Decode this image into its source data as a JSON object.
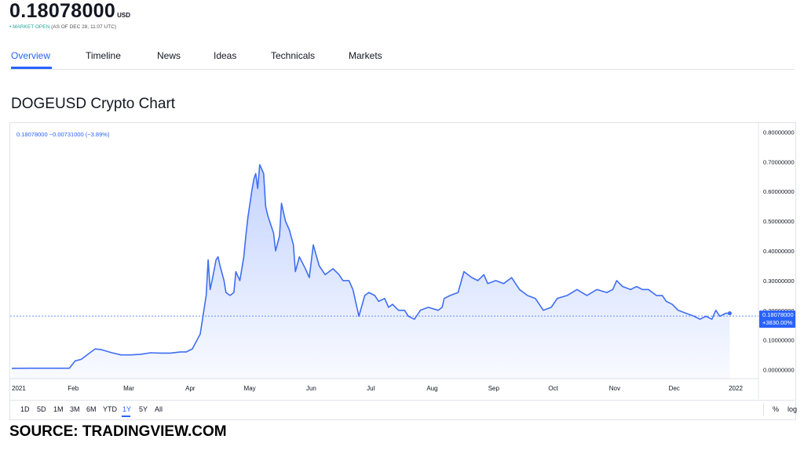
{
  "header": {
    "price": "0.18078000",
    "unit": "USD",
    "status_dot": "•",
    "market_status": "MARKET OPEN",
    "as_of": "(AS OF DEC 28, 11:07 UTC)"
  },
  "tabs": [
    {
      "label": "Overview",
      "active": true
    },
    {
      "label": "Timeline"
    },
    {
      "label": "News"
    },
    {
      "label": "Ideas"
    },
    {
      "label": "Technicals"
    },
    {
      "label": "Markets"
    }
  ],
  "section_title": "DOGEUSD Crypto Chart",
  "source": "SOURCE: TRADINGVIEW.COM",
  "colors": {
    "accent": "#2962ff",
    "line": "#3f6ef2",
    "market_open": "#26a69a"
  },
  "chart_data": {
    "type": "area",
    "series_header": "0.18078000  −0.00731000 (−3.89%)",
    "y_ticks": [
      "0.80000000",
      "0.70000000",
      "0.60000000",
      "0.50000000",
      "0.40000000",
      "0.30000000",
      "0.20000000",
      "0.10000000",
      "0.00000000"
    ],
    "y_tick_values": [
      0.8,
      0.7,
      0.6,
      0.5,
      0.4,
      0.3,
      0.2,
      0.1,
      0.0
    ],
    "ylim": [
      -0.03,
      0.83
    ],
    "x_tick_labels": [
      "2021",
      "Feb",
      "Mar",
      "Apr",
      "May",
      "Jun",
      "Jul",
      "Aug",
      "Sep",
      "Oct",
      "Nov",
      "Dec",
      "2022"
    ],
    "x_tick_days": [
      0,
      31,
      59,
      90,
      120,
      151,
      181,
      212,
      243,
      273,
      304,
      334,
      365
    ],
    "xlim_days": [
      0,
      365
    ],
    "last_value_label": "0.18078000",
    "last_change_label": "+3830.00%",
    "last_value": 0.1808,
    "x_days": [
      0,
      10,
      20,
      29,
      32,
      35,
      40,
      42,
      45,
      50,
      55,
      60,
      65,
      70,
      75,
      80,
      85,
      88,
      91,
      95,
      98,
      99,
      100,
      101,
      103,
      104,
      105,
      107,
      108,
      110,
      112,
      113,
      115,
      117,
      118,
      119,
      121,
      122,
      123,
      124,
      125,
      127,
      128,
      129,
      130,
      132,
      133,
      135,
      136,
      138,
      140,
      142,
      143,
      145,
      148,
      150,
      152,
      155,
      158,
      160,
      162,
      165,
      167,
      170,
      172,
      175,
      178,
      180,
      183,
      185,
      188,
      190,
      192,
      195,
      198,
      200,
      203,
      206,
      210,
      215,
      217,
      218,
      221,
      225,
      228,
      232,
      235,
      238,
      240,
      244,
      248,
      252,
      256,
      260,
      264,
      268,
      272,
      275,
      280,
      285,
      290,
      295,
      300,
      303,
      305,
      308,
      312,
      315,
      318,
      321,
      325,
      328,
      330,
      333,
      336,
      340,
      344,
      347,
      350,
      353,
      355,
      357,
      360,
      362
    ],
    "values": [
      0.0047,
      0.005,
      0.005,
      0.005,
      0.03,
      0.035,
      0.06,
      0.07,
      0.068,
      0.058,
      0.05,
      0.05,
      0.052,
      0.057,
      0.056,
      0.056,
      0.06,
      0.06,
      0.07,
      0.12,
      0.25,
      0.37,
      0.27,
      0.3,
      0.37,
      0.38,
      0.35,
      0.3,
      0.26,
      0.25,
      0.26,
      0.33,
      0.3,
      0.38,
      0.45,
      0.51,
      0.6,
      0.64,
      0.66,
      0.61,
      0.69,
      0.66,
      0.55,
      0.52,
      0.5,
      0.46,
      0.4,
      0.45,
      0.56,
      0.5,
      0.47,
      0.42,
      0.33,
      0.38,
      0.34,
      0.31,
      0.42,
      0.35,
      0.32,
      0.33,
      0.34,
      0.32,
      0.3,
      0.3,
      0.27,
      0.18,
      0.25,
      0.26,
      0.25,
      0.23,
      0.24,
      0.21,
      0.22,
      0.2,
      0.2,
      0.18,
      0.17,
      0.2,
      0.21,
      0.2,
      0.21,
      0.24,
      0.25,
      0.26,
      0.33,
      0.31,
      0.3,
      0.32,
      0.29,
      0.3,
      0.29,
      0.31,
      0.27,
      0.25,
      0.24,
      0.2,
      0.21,
      0.24,
      0.25,
      0.27,
      0.25,
      0.27,
      0.26,
      0.27,
      0.3,
      0.28,
      0.27,
      0.28,
      0.27,
      0.27,
      0.25,
      0.25,
      0.23,
      0.22,
      0.2,
      0.19,
      0.18,
      0.17,
      0.18,
      0.17,
      0.2,
      0.18,
      0.19,
      0.19
    ]
  },
  "range_buttons": [
    {
      "label": "1D"
    },
    {
      "label": "5D"
    },
    {
      "label": "1M"
    },
    {
      "label": "3M"
    },
    {
      "label": "6M"
    },
    {
      "label": "YTD"
    },
    {
      "label": "1Y",
      "active": true
    },
    {
      "label": "5Y"
    },
    {
      "label": "All"
    }
  ],
  "scale_toggles": {
    "percent": "%",
    "log": "log"
  }
}
